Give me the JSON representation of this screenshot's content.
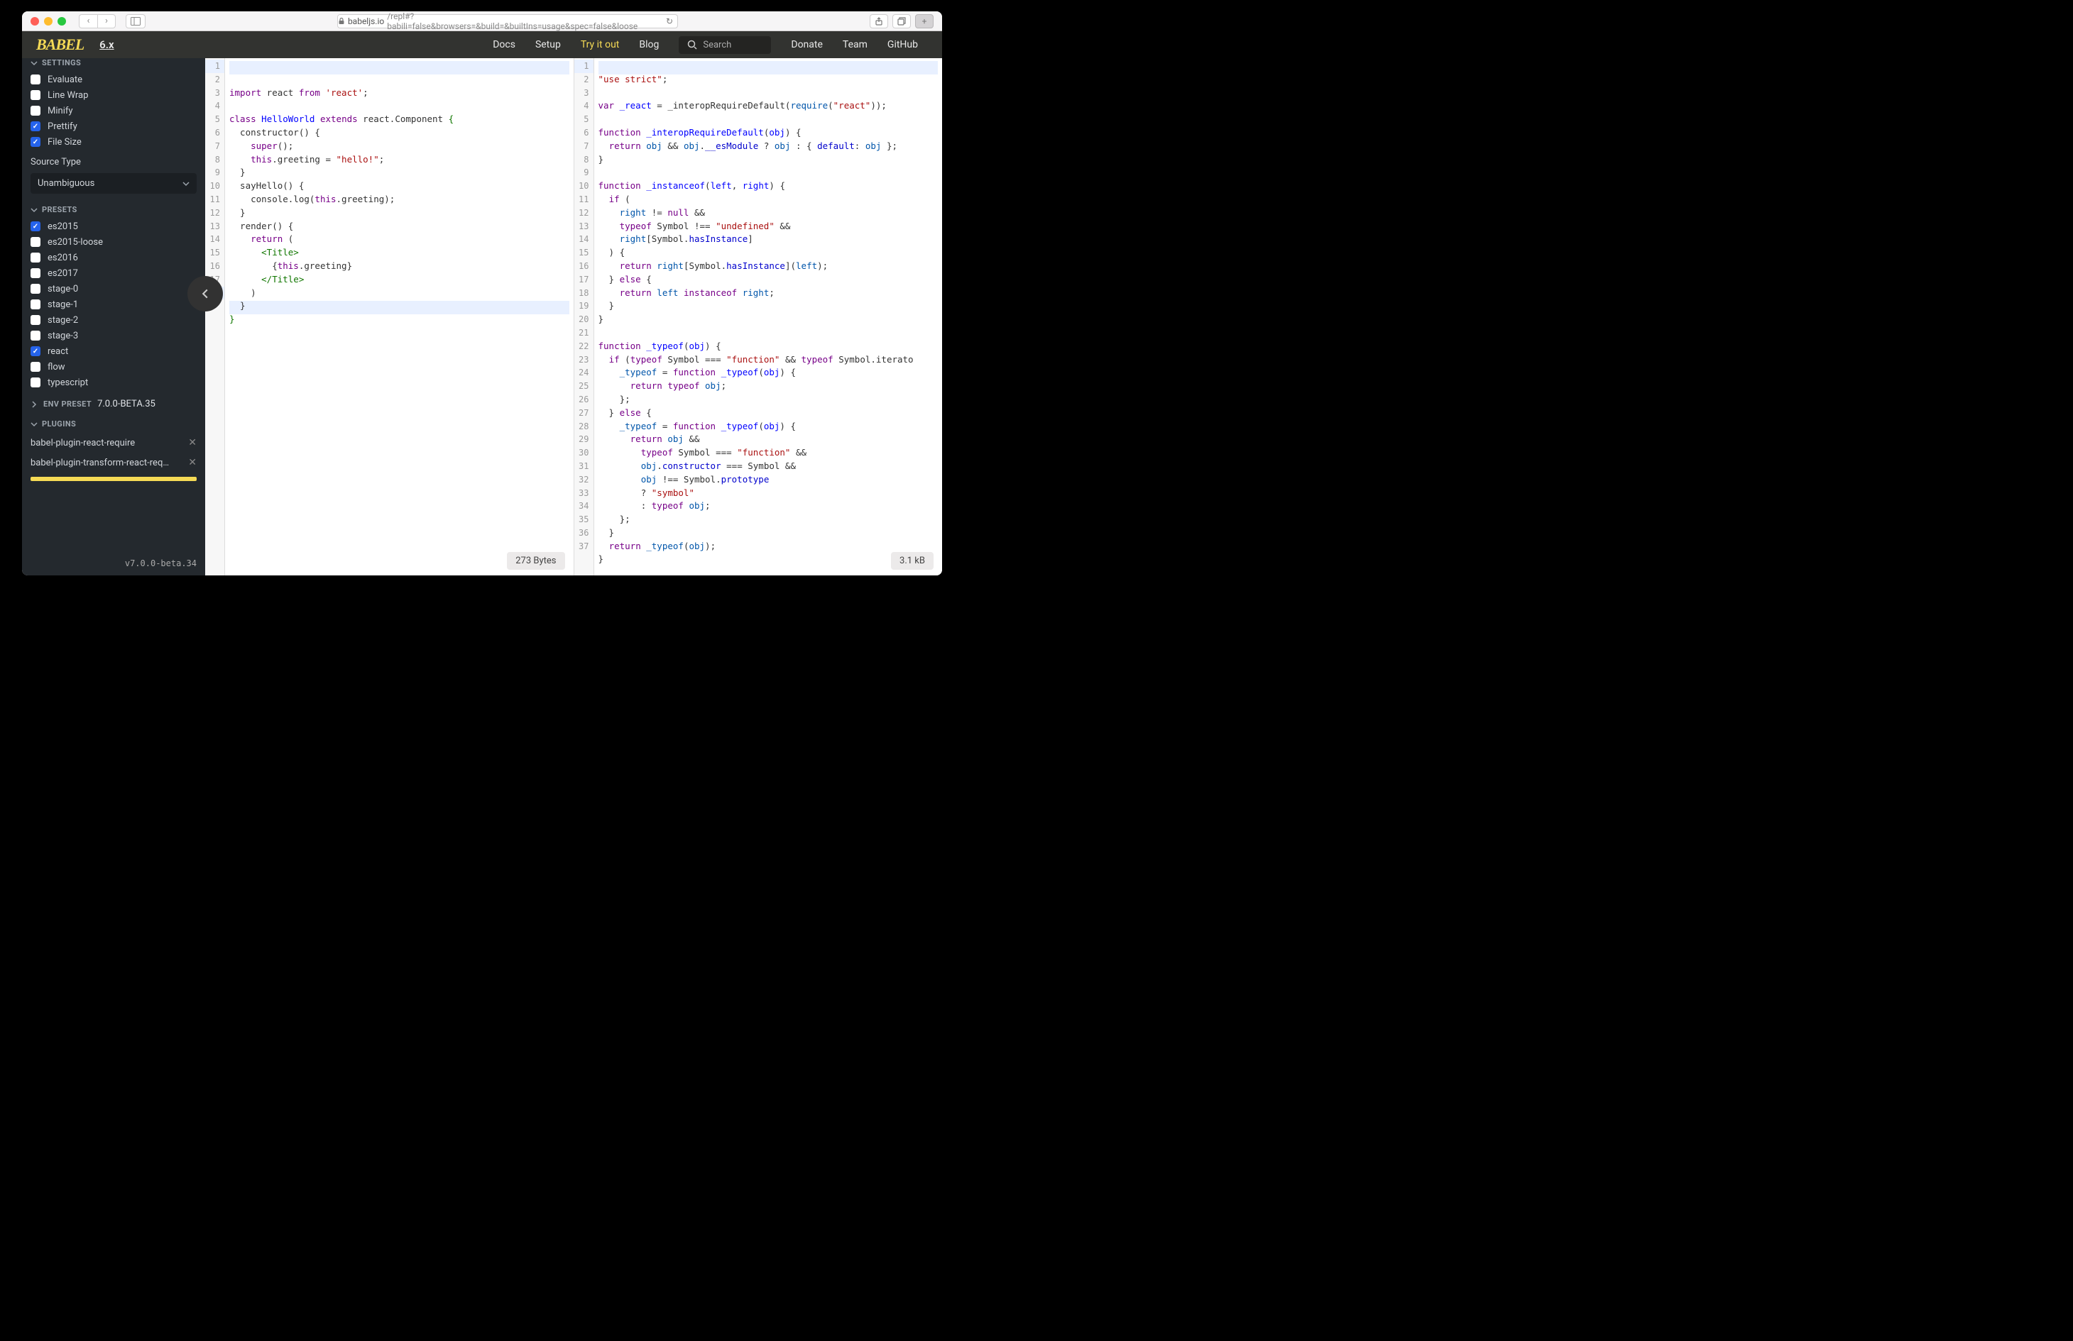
{
  "browser": {
    "url_host": "babeljs.io",
    "url_path": "/repl#?babili=false&browsers=&build=&builtIns=usage&spec=false&loose"
  },
  "header": {
    "logo": "BABEL",
    "version_link": "6.x",
    "nav": {
      "docs": "Docs",
      "setup": "Setup",
      "tryit": "Try it out",
      "blog": "Blog",
      "donate": "Donate",
      "team": "Team",
      "github": "GitHub"
    },
    "search_placeholder": "Search"
  },
  "sidebar": {
    "sections": {
      "settings": "SETTINGS",
      "presets": "PRESETS",
      "env_preset": "ENV PRESET",
      "plugins": "PLUGINS"
    },
    "settings_items": [
      {
        "label": "Evaluate",
        "checked": false
      },
      {
        "label": "Line Wrap",
        "checked": false
      },
      {
        "label": "Minify",
        "checked": false
      },
      {
        "label": "Prettify",
        "checked": true
      },
      {
        "label": "File Size",
        "checked": true
      }
    ],
    "source_type_label": "Source Type",
    "source_type_value": "Unambiguous",
    "presets": [
      {
        "label": "es2015",
        "checked": true
      },
      {
        "label": "es2015-loose",
        "checked": false
      },
      {
        "label": "es2016",
        "checked": false
      },
      {
        "label": "es2017",
        "checked": false
      },
      {
        "label": "stage-0",
        "checked": false
      },
      {
        "label": "stage-1",
        "checked": false
      },
      {
        "label": "stage-2",
        "checked": false
      },
      {
        "label": "stage-3",
        "checked": false
      },
      {
        "label": "react",
        "checked": true
      },
      {
        "label": "flow",
        "checked": false
      },
      {
        "label": "typescript",
        "checked": false
      }
    ],
    "env_preset_version": "7.0.0-BETA.35",
    "plugins": [
      "babel-plugin-react-require",
      "babel-plugin-transform-react-require"
    ],
    "footer_version": "v7.0.0-beta.34"
  },
  "editor": {
    "input_lines": [
      [
        [
          "kw",
          "import"
        ],
        [
          "op",
          " react "
        ],
        [
          "kw",
          "from"
        ],
        [
          "op",
          " "
        ],
        [
          "str",
          "'react'"
        ],
        [
          "op",
          ";"
        ]
      ],
      [],
      [
        [
          "kw",
          "class"
        ],
        [
          "op",
          " "
        ],
        [
          "def",
          "HelloWorld"
        ],
        [
          "op",
          " "
        ],
        [
          "kw",
          "extends"
        ],
        [
          "op",
          " react.Component "
        ],
        [
          "tag",
          "{"
        ]
      ],
      [
        [
          "op",
          "  constructor() {"
        ]
      ],
      [
        [
          "op",
          "    "
        ],
        [
          "kw",
          "super"
        ],
        [
          "op",
          "();"
        ]
      ],
      [
        [
          "op",
          "    "
        ],
        [
          "kw",
          "this"
        ],
        [
          "op",
          ".greeting = "
        ],
        [
          "str",
          "\"hello!\""
        ],
        [
          "op",
          ";"
        ]
      ],
      [
        [
          "op",
          "  }"
        ]
      ],
      [
        [
          "op",
          "  sayHello() {"
        ]
      ],
      [
        [
          "op",
          "    console.log("
        ],
        [
          "kw",
          "this"
        ],
        [
          "op",
          ".greeting);"
        ]
      ],
      [
        [
          "op",
          "  }"
        ]
      ],
      [
        [
          "op",
          "  render() {"
        ]
      ],
      [
        [
          "op",
          "    "
        ],
        [
          "kw",
          "return"
        ],
        [
          "op",
          " ("
        ]
      ],
      [
        [
          "op",
          "      "
        ],
        [
          "tag",
          "<Title>"
        ]
      ],
      [
        [
          "op",
          "        {"
        ],
        [
          "kw",
          "this"
        ],
        [
          "op",
          ".greeting}"
        ]
      ],
      [
        [
          "op",
          "      "
        ],
        [
          "tag",
          "</Title>"
        ]
      ],
      [
        [
          "op",
          "    )"
        ]
      ],
      [
        [
          "op",
          "  }"
        ]
      ],
      [
        [
          "tag",
          "}"
        ]
      ]
    ],
    "input_badge": "273 Bytes",
    "input_highlight_line": 18,
    "input_top_highlight": true,
    "output_lines": [
      [
        [
          "str",
          "\"use strict\""
        ],
        [
          "op",
          ";"
        ]
      ],
      [],
      [
        [
          "kw",
          "var"
        ],
        [
          "op",
          " "
        ],
        [
          "def",
          "_react"
        ],
        [
          "op",
          " = _interopRequireDefault("
        ],
        [
          "var2",
          "require"
        ],
        [
          "op",
          "("
        ],
        [
          "str",
          "\"react\""
        ],
        [
          "op",
          "));"
        ]
      ],
      [],
      [
        [
          "kw",
          "function"
        ],
        [
          "op",
          " "
        ],
        [
          "def",
          "_interopRequireDefault"
        ],
        [
          "op",
          "("
        ],
        [
          "def",
          "obj"
        ],
        [
          "op",
          ") {"
        ]
      ],
      [
        [
          "op",
          "  "
        ],
        [
          "kw",
          "return"
        ],
        [
          "op",
          " "
        ],
        [
          "var2",
          "obj"
        ],
        [
          "op",
          " && "
        ],
        [
          "var2",
          "obj"
        ],
        [
          "op",
          "."
        ],
        [
          "attr",
          "__esModule"
        ],
        [
          "op",
          " ? "
        ],
        [
          "var2",
          "obj"
        ],
        [
          "op",
          " : { "
        ],
        [
          "attr",
          "default"
        ],
        [
          "op",
          ": "
        ],
        [
          "var2",
          "obj"
        ],
        [
          "op",
          " };"
        ]
      ],
      [
        [
          "op",
          "}"
        ]
      ],
      [],
      [
        [
          "kw",
          "function"
        ],
        [
          "op",
          " "
        ],
        [
          "def",
          "_instanceof"
        ],
        [
          "op",
          "("
        ],
        [
          "def",
          "left"
        ],
        [
          "op",
          ", "
        ],
        [
          "def",
          "right"
        ],
        [
          "op",
          ") {"
        ]
      ],
      [
        [
          "op",
          "  "
        ],
        [
          "kw",
          "if"
        ],
        [
          "op",
          " ("
        ]
      ],
      [
        [
          "op",
          "    "
        ],
        [
          "var2",
          "right"
        ],
        [
          "op",
          " != "
        ],
        [
          "kw",
          "null"
        ],
        [
          "op",
          " &&"
        ]
      ],
      [
        [
          "op",
          "    "
        ],
        [
          "kw",
          "typeof"
        ],
        [
          "op",
          " Symbol !== "
        ],
        [
          "str",
          "\"undefined\""
        ],
        [
          "op",
          " &&"
        ]
      ],
      [
        [
          "op",
          "    "
        ],
        [
          "var2",
          "right"
        ],
        [
          "op",
          "[Symbol."
        ],
        [
          "attr",
          "hasInstance"
        ],
        [
          "op",
          "]"
        ]
      ],
      [
        [
          "op",
          "  ) {"
        ]
      ],
      [
        [
          "op",
          "    "
        ],
        [
          "kw",
          "return"
        ],
        [
          "op",
          " "
        ],
        [
          "var2",
          "right"
        ],
        [
          "op",
          "[Symbol."
        ],
        [
          "attr",
          "hasInstance"
        ],
        [
          "op",
          "]("
        ],
        [
          "var2",
          "left"
        ],
        [
          "op",
          ");"
        ]
      ],
      [
        [
          "op",
          "  } "
        ],
        [
          "kw",
          "else"
        ],
        [
          "op",
          " {"
        ]
      ],
      [
        [
          "op",
          "    "
        ],
        [
          "kw",
          "return"
        ],
        [
          "op",
          " "
        ],
        [
          "var2",
          "left"
        ],
        [
          "op",
          " "
        ],
        [
          "kw",
          "instanceof"
        ],
        [
          "op",
          " "
        ],
        [
          "var2",
          "right"
        ],
        [
          "op",
          ";"
        ]
      ],
      [
        [
          "op",
          "  }"
        ]
      ],
      [
        [
          "op",
          "}"
        ]
      ],
      [],
      [
        [
          "kw",
          "function"
        ],
        [
          "op",
          " "
        ],
        [
          "def",
          "_typeof"
        ],
        [
          "op",
          "("
        ],
        [
          "def",
          "obj"
        ],
        [
          "op",
          ") {"
        ]
      ],
      [
        [
          "op",
          "  "
        ],
        [
          "kw",
          "if"
        ],
        [
          "op",
          " ("
        ],
        [
          "kw",
          "typeof"
        ],
        [
          "op",
          " Symbol === "
        ],
        [
          "str",
          "\"function\""
        ],
        [
          "op",
          " && "
        ],
        [
          "kw",
          "typeof"
        ],
        [
          "op",
          " Symbol.iterato"
        ]
      ],
      [
        [
          "op",
          "    "
        ],
        [
          "var2",
          "_typeof"
        ],
        [
          "op",
          " = "
        ],
        [
          "kw",
          "function"
        ],
        [
          "op",
          " "
        ],
        [
          "def",
          "_typeof"
        ],
        [
          "op",
          "("
        ],
        [
          "def",
          "obj"
        ],
        [
          "op",
          ") {"
        ]
      ],
      [
        [
          "op",
          "      "
        ],
        [
          "kw",
          "return"
        ],
        [
          "op",
          " "
        ],
        [
          "kw",
          "typeof"
        ],
        [
          "op",
          " "
        ],
        [
          "var2",
          "obj"
        ],
        [
          "op",
          ";"
        ]
      ],
      [
        [
          "op",
          "    };"
        ]
      ],
      [
        [
          "op",
          "  } "
        ],
        [
          "kw",
          "else"
        ],
        [
          "op",
          " {"
        ]
      ],
      [
        [
          "op",
          "    "
        ],
        [
          "var2",
          "_typeof"
        ],
        [
          "op",
          " = "
        ],
        [
          "kw",
          "function"
        ],
        [
          "op",
          " "
        ],
        [
          "def",
          "_typeof"
        ],
        [
          "op",
          "("
        ],
        [
          "def",
          "obj"
        ],
        [
          "op",
          ") {"
        ]
      ],
      [
        [
          "op",
          "      "
        ],
        [
          "kw",
          "return"
        ],
        [
          "op",
          " "
        ],
        [
          "var2",
          "obj"
        ],
        [
          "op",
          " &&"
        ]
      ],
      [
        [
          "op",
          "        "
        ],
        [
          "kw",
          "typeof"
        ],
        [
          "op",
          " Symbol === "
        ],
        [
          "str",
          "\"function\""
        ],
        [
          "op",
          " &&"
        ]
      ],
      [
        [
          "op",
          "        "
        ],
        [
          "var2",
          "obj"
        ],
        [
          "op",
          "."
        ],
        [
          "attr",
          "constructor"
        ],
        [
          "op",
          " === Symbol &&"
        ]
      ],
      [
        [
          "op",
          "        "
        ],
        [
          "var2",
          "obj"
        ],
        [
          "op",
          " !== Symbol."
        ],
        [
          "attr",
          "prototype"
        ]
      ],
      [
        [
          "op",
          "        ? "
        ],
        [
          "str",
          "\"symbol\""
        ]
      ],
      [
        [
          "op",
          "        : "
        ],
        [
          "kw",
          "typeof"
        ],
        [
          "op",
          " "
        ],
        [
          "var2",
          "obj"
        ],
        [
          "op",
          ";"
        ]
      ],
      [
        [
          "op",
          "    };"
        ]
      ],
      [
        [
          "op",
          "  }"
        ]
      ],
      [
        [
          "op",
          "  "
        ],
        [
          "kw",
          "return"
        ],
        [
          "op",
          " "
        ],
        [
          "var2",
          "_typeof"
        ],
        [
          "op",
          "("
        ],
        [
          "var2",
          "obj"
        ],
        [
          "op",
          ");"
        ]
      ],
      [
        [
          "op",
          "}"
        ]
      ]
    ],
    "output_badge": "3.1 kB",
    "output_top_highlight": true
  }
}
